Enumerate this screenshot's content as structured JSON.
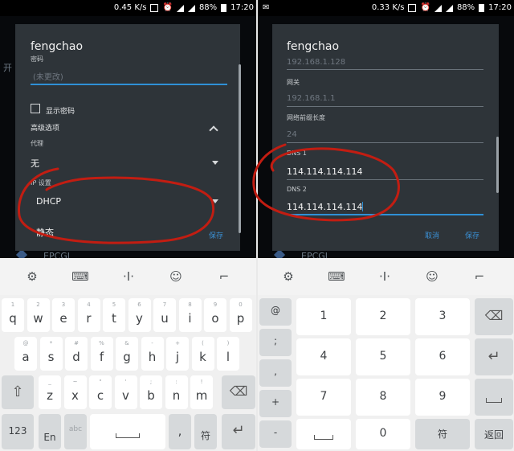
{
  "left": {
    "status": {
      "speed": "0.45 K/s",
      "battery": "88%",
      "time": "17:20"
    },
    "background": {
      "top_label": "开",
      "bottom_label": "EPCGL"
    },
    "dialog": {
      "title": "fengchao",
      "password_label": "密码",
      "password_placeholder": "(未更改)",
      "show_password_label": "显示密码",
      "advanced_label": "高级选项",
      "proxy_label": "代理",
      "proxy_value": "无",
      "ip_label": "IP 设置",
      "ip_value": "DHCP",
      "dropdown_option": "静态",
      "save_label": "保存"
    },
    "keyboard": {
      "toolbar_icons": [
        "settings-icon",
        "keyboard-icon",
        "text-cursor-icon",
        "emoji-icon",
        "hide-keyboard-icon"
      ],
      "row1": [
        {
          "main": "q",
          "sub": "1"
        },
        {
          "main": "w",
          "sub": "2"
        },
        {
          "main": "e",
          "sub": "3"
        },
        {
          "main": "r",
          "sub": "4"
        },
        {
          "main": "t",
          "sub": "5"
        },
        {
          "main": "y",
          "sub": "6"
        },
        {
          "main": "u",
          "sub": "7"
        },
        {
          "main": "i",
          "sub": "8"
        },
        {
          "main": "o",
          "sub": "9"
        },
        {
          "main": "p",
          "sub": "0"
        }
      ],
      "row2": [
        {
          "main": "a",
          "sub": "@"
        },
        {
          "main": "s",
          "sub": "*"
        },
        {
          "main": "d",
          "sub": "#"
        },
        {
          "main": "f",
          "sub": "%"
        },
        {
          "main": "g",
          "sub": "&"
        },
        {
          "main": "h",
          "sub": "-"
        },
        {
          "main": "j",
          "sub": "+"
        },
        {
          "main": "k",
          "sub": "("
        },
        {
          "main": "l",
          "sub": ")"
        }
      ],
      "row3": [
        {
          "main": "z",
          "sub": "_"
        },
        {
          "main": "x",
          "sub": "~"
        },
        {
          "main": "c",
          "sub": "\""
        },
        {
          "main": "v",
          "sub": "'"
        },
        {
          "main": "b",
          "sub": ";"
        },
        {
          "main": "n",
          "sub": ":"
        },
        {
          "main": "m",
          "sub": "!"
        }
      ],
      "numbers_key": "123",
      "lang_key": "En",
      "lang_sub": "abc",
      "period_key": ",",
      "fu_key": "符"
    }
  },
  "right": {
    "status": {
      "speed": "0.33 K/s",
      "battery": "88%",
      "time": "17:20"
    },
    "background": {
      "bottom_label": "EPCGL"
    },
    "dialog": {
      "title": "fengchao",
      "ip_partial": "192.168.1.128",
      "gateway_label": "网关",
      "gateway_value": "192.168.1.1",
      "prefix_label": "网络前缀长度",
      "prefix_value": "24",
      "dns1_label": "DNS 1",
      "dns1_value": "114.114.114.114",
      "dns2_label": "DNS 2",
      "dns2_value": "114.114.114.114",
      "cancel_label": "取消",
      "save_label": "保存"
    },
    "keyboard": {
      "side_keys": [
        "@",
        ";",
        ",",
        "+",
        "-"
      ],
      "digits": [
        "1",
        "2",
        "3",
        "4",
        "5",
        "6",
        "7",
        "8",
        "9"
      ],
      "zero": "0",
      "fu_key": "符",
      "back_label": "返回"
    }
  },
  "colors": {
    "dialog_bg": "#2e3439",
    "accent": "#2f90d6",
    "annotation": "#c21d12"
  }
}
